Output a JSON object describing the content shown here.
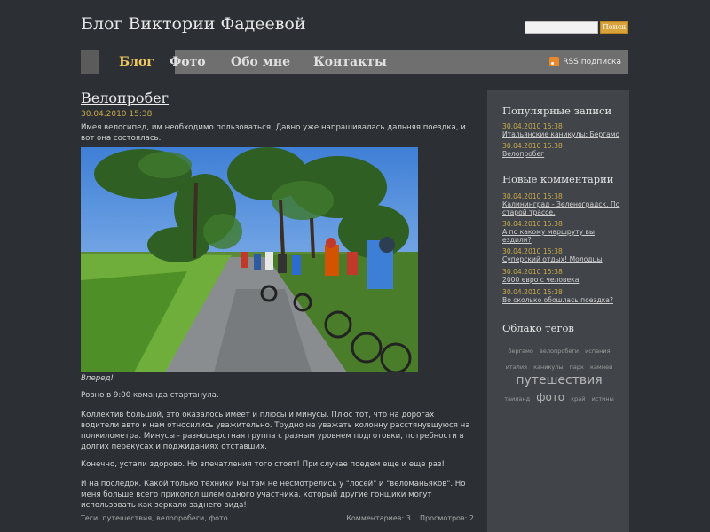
{
  "header": {
    "site_title": "Блог Виктории Фадеевой",
    "search": {
      "placeholder": "",
      "button_label": "Поиск"
    }
  },
  "nav": {
    "items": [
      {
        "label": "Блог",
        "active": true
      },
      {
        "label": "Фото",
        "active": false
      },
      {
        "label": "Обо мне",
        "active": false
      },
      {
        "label": "Контакты",
        "active": false
      }
    ],
    "rss_label": "RSS подписка",
    "rss_icon": "rss-icon"
  },
  "post": {
    "title": "Велопробег",
    "date": "30.04.2010 15:38",
    "intro": "Имея велосипед, им необходимо пользоваться. Давно уже напрашивалась дальняя поездка, и вот она состоялась.",
    "image_caption": "Вперед!",
    "paragraphs": [
      "Ровно в 9:00 команда стартанула.",
      "Коллектив большой, это оказалось имеет и плюсы и минусы. Плюс тот, что на дорогах водители авто к нам относились уважительно. Трудно не уважать колонну расстянувшуюся на полкилометра. Минусы - разношерстная группа с разным уровнем подготовки, потребности в долгих перекусах и поджиданиях отставших.",
      "Конечно, устали здорово. Но впечатления того стоят! При случае поедем еще и еще раз!",
      "И на последок. Какой только техники мы там не несмотрелись у \"лосей\" и \"веломаньяков\". Но меня больше всего приколол шлем одного участника, который другие гонщики могут использовать как зеркало заднего вида!"
    ],
    "tags_prefix": "Теги:",
    "tags": [
      "путешествия",
      "велопробеги",
      "фото"
    ],
    "comments_label": "Комментариев: 3",
    "views_label": "Просмотров: 2"
  },
  "sidebar": {
    "popular": {
      "heading": "Популярные записи",
      "items": [
        {
          "date": "30.04.2010 15:38",
          "title": "Итальянские каникулы: Бергамо"
        },
        {
          "date": "30.04.2010 15:38",
          "title": "Велопробег"
        }
      ]
    },
    "comments": {
      "heading": "Новые комментарии",
      "items": [
        {
          "date": "30.04.2010 15:38",
          "title": "Калининград - Зеленоградск. По старой трассе."
        },
        {
          "date": "30.04.2010 15:38",
          "title": "А по какому маршруту вы ездили?"
        },
        {
          "date": "30.04.2010 15:38",
          "title": "Суперский отдых! Молодцы"
        },
        {
          "date": "30.04.2010 15:38",
          "title": "2000 евро с человека"
        },
        {
          "date": "30.04.2010 15:38",
          "title": "Во сколько обошлась поездка?"
        }
      ]
    },
    "tag_cloud": {
      "heading": "Облако тегов",
      "tags": [
        {
          "label": "бергамо",
          "weight": 1
        },
        {
          "label": "велопробеги",
          "weight": 1
        },
        {
          "label": "испания",
          "weight": 1
        },
        {
          "label": "италия",
          "weight": 1
        },
        {
          "label": "каникулы",
          "weight": 1
        },
        {
          "label": "парк",
          "weight": 1
        },
        {
          "label": "камней",
          "weight": 1
        },
        {
          "label": "путешествия",
          "weight": 3
        },
        {
          "label": "таиланд",
          "weight": 1
        },
        {
          "label": "фото",
          "weight": 2
        },
        {
          "label": "край",
          "weight": 1
        },
        {
          "label": "истины",
          "weight": 1
        }
      ]
    }
  },
  "colors": {
    "background": "#2c3035",
    "sidebar": "#41454a",
    "accent": "#f1c760",
    "date": "#c9a94a",
    "search_button": "#d9a23a"
  }
}
